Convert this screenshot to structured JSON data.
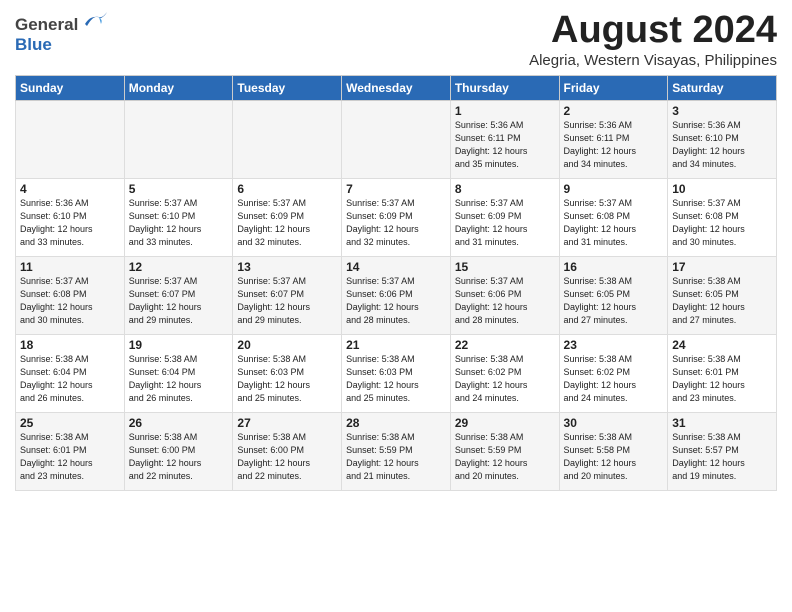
{
  "title": "August 2024",
  "location": "Alegria, Western Visayas, Philippines",
  "logo": {
    "line1": "General",
    "line2": "Blue"
  },
  "days_of_week": [
    "Sunday",
    "Monday",
    "Tuesday",
    "Wednesday",
    "Thursday",
    "Friday",
    "Saturday"
  ],
  "weeks": [
    [
      {
        "num": "",
        "info": ""
      },
      {
        "num": "",
        "info": ""
      },
      {
        "num": "",
        "info": ""
      },
      {
        "num": "",
        "info": ""
      },
      {
        "num": "1",
        "info": "Sunrise: 5:36 AM\nSunset: 6:11 PM\nDaylight: 12 hours\nand 35 minutes."
      },
      {
        "num": "2",
        "info": "Sunrise: 5:36 AM\nSunset: 6:11 PM\nDaylight: 12 hours\nand 34 minutes."
      },
      {
        "num": "3",
        "info": "Sunrise: 5:36 AM\nSunset: 6:10 PM\nDaylight: 12 hours\nand 34 minutes."
      }
    ],
    [
      {
        "num": "4",
        "info": "Sunrise: 5:36 AM\nSunset: 6:10 PM\nDaylight: 12 hours\nand 33 minutes."
      },
      {
        "num": "5",
        "info": "Sunrise: 5:37 AM\nSunset: 6:10 PM\nDaylight: 12 hours\nand 33 minutes."
      },
      {
        "num": "6",
        "info": "Sunrise: 5:37 AM\nSunset: 6:09 PM\nDaylight: 12 hours\nand 32 minutes."
      },
      {
        "num": "7",
        "info": "Sunrise: 5:37 AM\nSunset: 6:09 PM\nDaylight: 12 hours\nand 32 minutes."
      },
      {
        "num": "8",
        "info": "Sunrise: 5:37 AM\nSunset: 6:09 PM\nDaylight: 12 hours\nand 31 minutes."
      },
      {
        "num": "9",
        "info": "Sunrise: 5:37 AM\nSunset: 6:08 PM\nDaylight: 12 hours\nand 31 minutes."
      },
      {
        "num": "10",
        "info": "Sunrise: 5:37 AM\nSunset: 6:08 PM\nDaylight: 12 hours\nand 30 minutes."
      }
    ],
    [
      {
        "num": "11",
        "info": "Sunrise: 5:37 AM\nSunset: 6:08 PM\nDaylight: 12 hours\nand 30 minutes."
      },
      {
        "num": "12",
        "info": "Sunrise: 5:37 AM\nSunset: 6:07 PM\nDaylight: 12 hours\nand 29 minutes."
      },
      {
        "num": "13",
        "info": "Sunrise: 5:37 AM\nSunset: 6:07 PM\nDaylight: 12 hours\nand 29 minutes."
      },
      {
        "num": "14",
        "info": "Sunrise: 5:37 AM\nSunset: 6:06 PM\nDaylight: 12 hours\nand 28 minutes."
      },
      {
        "num": "15",
        "info": "Sunrise: 5:37 AM\nSunset: 6:06 PM\nDaylight: 12 hours\nand 28 minutes."
      },
      {
        "num": "16",
        "info": "Sunrise: 5:38 AM\nSunset: 6:05 PM\nDaylight: 12 hours\nand 27 minutes."
      },
      {
        "num": "17",
        "info": "Sunrise: 5:38 AM\nSunset: 6:05 PM\nDaylight: 12 hours\nand 27 minutes."
      }
    ],
    [
      {
        "num": "18",
        "info": "Sunrise: 5:38 AM\nSunset: 6:04 PM\nDaylight: 12 hours\nand 26 minutes."
      },
      {
        "num": "19",
        "info": "Sunrise: 5:38 AM\nSunset: 6:04 PM\nDaylight: 12 hours\nand 26 minutes."
      },
      {
        "num": "20",
        "info": "Sunrise: 5:38 AM\nSunset: 6:03 PM\nDaylight: 12 hours\nand 25 minutes."
      },
      {
        "num": "21",
        "info": "Sunrise: 5:38 AM\nSunset: 6:03 PM\nDaylight: 12 hours\nand 25 minutes."
      },
      {
        "num": "22",
        "info": "Sunrise: 5:38 AM\nSunset: 6:02 PM\nDaylight: 12 hours\nand 24 minutes."
      },
      {
        "num": "23",
        "info": "Sunrise: 5:38 AM\nSunset: 6:02 PM\nDaylight: 12 hours\nand 24 minutes."
      },
      {
        "num": "24",
        "info": "Sunrise: 5:38 AM\nSunset: 6:01 PM\nDaylight: 12 hours\nand 23 minutes."
      }
    ],
    [
      {
        "num": "25",
        "info": "Sunrise: 5:38 AM\nSunset: 6:01 PM\nDaylight: 12 hours\nand 23 minutes."
      },
      {
        "num": "26",
        "info": "Sunrise: 5:38 AM\nSunset: 6:00 PM\nDaylight: 12 hours\nand 22 minutes."
      },
      {
        "num": "27",
        "info": "Sunrise: 5:38 AM\nSunset: 6:00 PM\nDaylight: 12 hours\nand 22 minutes."
      },
      {
        "num": "28",
        "info": "Sunrise: 5:38 AM\nSunset: 5:59 PM\nDaylight: 12 hours\nand 21 minutes."
      },
      {
        "num": "29",
        "info": "Sunrise: 5:38 AM\nSunset: 5:59 PM\nDaylight: 12 hours\nand 20 minutes."
      },
      {
        "num": "30",
        "info": "Sunrise: 5:38 AM\nSunset: 5:58 PM\nDaylight: 12 hours\nand 20 minutes."
      },
      {
        "num": "31",
        "info": "Sunrise: 5:38 AM\nSunset: 5:57 PM\nDaylight: 12 hours\nand 19 minutes."
      }
    ]
  ]
}
